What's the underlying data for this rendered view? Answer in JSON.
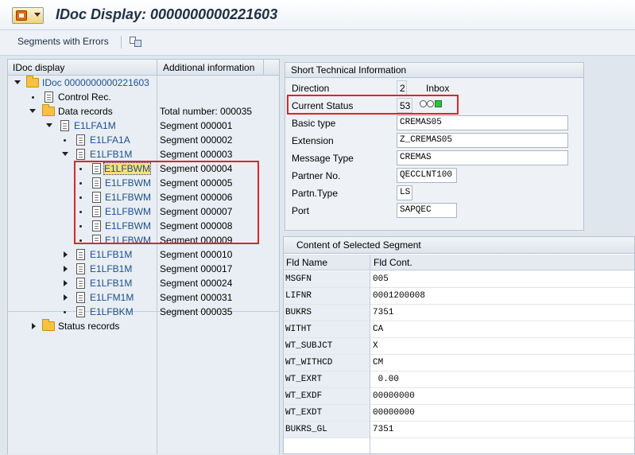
{
  "window": {
    "title": "IDoc Display: 0000000000221603"
  },
  "toolbar": {
    "segments_with_errors": "Segments with Errors",
    "icon": "display-structure-icon"
  },
  "tree": {
    "header_col1": "IDoc display",
    "header_col2": "Additional information",
    "root": "IDoc 0000000000221603",
    "control_rec": "Control Rec.",
    "data_records": "Data records",
    "data_records_info": "Total number: 000035",
    "e1lfa1m": "E1LFA1M",
    "e1lfa1m_info": "Segment 000001",
    "e1lfa1a": "E1LFA1A",
    "e1lfa1a_info": "Segment 000002",
    "e1lfb1m": "E1LFB1M",
    "e1lfb1m_info": "Segment 000003",
    "children": [
      {
        "label": "E1LFBWM",
        "info": "Segment 000004"
      },
      {
        "label": "E1LFBWM",
        "info": "Segment 000005"
      },
      {
        "label": "E1LFBWM",
        "info": "Segment 000006"
      },
      {
        "label": "E1LFBWM",
        "info": "Segment 000007"
      },
      {
        "label": "E1LFBWM",
        "info": "Segment 000008"
      },
      {
        "label": "E1LFBWM",
        "info": "Segment 000009"
      }
    ],
    "more": [
      {
        "label": "E1LFB1M",
        "info": "Segment 000010"
      },
      {
        "label": "E1LFB1M",
        "info": "Segment 000017"
      },
      {
        "label": "E1LFB1M",
        "info": "Segment 000024"
      },
      {
        "label": "E1LFM1M",
        "info": "Segment 000031"
      },
      {
        "label": "E1LFBKM",
        "info": "Segment 000035"
      }
    ],
    "status_records": "Status records"
  },
  "short_info": {
    "title": "Short Technical Information",
    "direction_label": "Direction",
    "direction_value": "2",
    "direction_text": "Inbox",
    "status_label": "Current Status",
    "status_value": "53",
    "basic_type_label": "Basic type",
    "basic_type_value": "CREMAS05",
    "extension_label": "Extension",
    "extension_value": "Z_CREMAS05",
    "message_type_label": "Message Type",
    "message_type_value": "CREMAS",
    "partner_no_label": "Partner No.",
    "partner_no_value": "QECCLNT100",
    "partn_type_label": "Partn.Type",
    "partn_type_value": "LS",
    "port_label": "Port",
    "port_value": "SAPQEC"
  },
  "segment_content": {
    "title": "Content of Selected Segment",
    "col_name": "Fld Name",
    "col_cont": "Fld Cont.",
    "rows": [
      {
        "name": "MSGFN",
        "value": "005"
      },
      {
        "name": "LIFNR",
        "value": "0001200008"
      },
      {
        "name": "BUKRS",
        "value": "7351"
      },
      {
        "name": "WITHT",
        "value": "CA"
      },
      {
        "name": "WT_SUBJCT",
        "value": "X"
      },
      {
        "name": "WT_WITHCD",
        "value": "CM"
      },
      {
        "name": "WT_EXRT",
        "value": " 0.00"
      },
      {
        "name": "WT_EXDF",
        "value": "00000000"
      },
      {
        "name": "WT_EXDT",
        "value": "00000000"
      },
      {
        "name": "BUKRS_GL",
        "value": "7351"
      }
    ]
  },
  "colors": {
    "highlight_border": "#d9262c",
    "status_light": "#29c43d"
  }
}
